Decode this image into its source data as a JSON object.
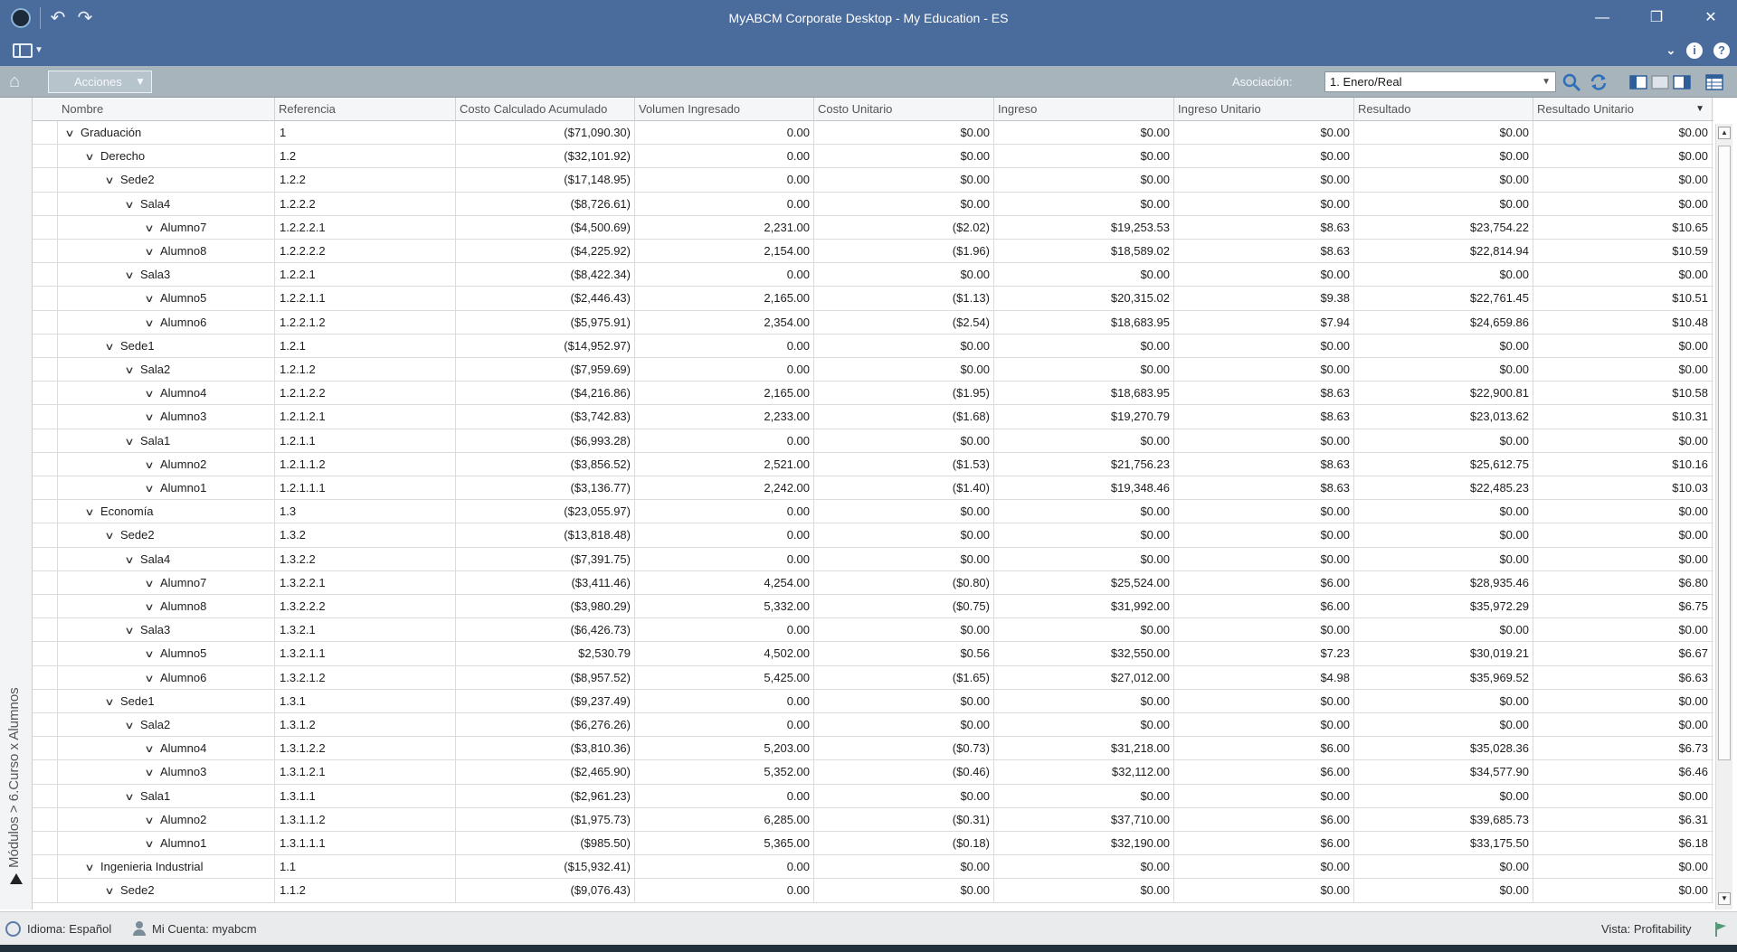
{
  "window": {
    "title": "MyABCM Corporate Desktop - My Education - ES",
    "undo_icon": "undo-icon",
    "redo_icon": "redo-icon"
  },
  "toolbar": {
    "acciones_label": "Acciones",
    "asociacion_label": "Asociación:",
    "asociacion_value": "1. Enero/Real"
  },
  "breadcrumb": "Módulos > 6.Curso x Alumnos",
  "columns": [
    "Nombre",
    "Referencia",
    "Costo Calculado Acumulado",
    "Volumen Ingresado",
    "Costo Unitario",
    "Ingreso",
    "Ingreso Unitario",
    "Resultado",
    "Resultado Unitario"
  ],
  "rows": [
    {
      "level": 0,
      "name": "Graduación",
      "ref": "1",
      "costo_acum": "($71,090.30)",
      "volumen": "0.00",
      "costo_unit": "$0.00",
      "ingreso": "$0.00",
      "ingreso_unit": "$0.00",
      "resultado": "$0.00",
      "resultado_unit": "$0.00"
    },
    {
      "level": 1,
      "name": "Derecho",
      "ref": "1.2",
      "costo_acum": "($32,101.92)",
      "volumen": "0.00",
      "costo_unit": "$0.00",
      "ingreso": "$0.00",
      "ingreso_unit": "$0.00",
      "resultado": "$0.00",
      "resultado_unit": "$0.00"
    },
    {
      "level": 2,
      "name": "Sede2",
      "ref": "1.2.2",
      "costo_acum": "($17,148.95)",
      "volumen": "0.00",
      "costo_unit": "$0.00",
      "ingreso": "$0.00",
      "ingreso_unit": "$0.00",
      "resultado": "$0.00",
      "resultado_unit": "$0.00"
    },
    {
      "level": 3,
      "name": "Sala4",
      "ref": "1.2.2.2",
      "costo_acum": "($8,726.61)",
      "volumen": "0.00",
      "costo_unit": "$0.00",
      "ingreso": "$0.00",
      "ingreso_unit": "$0.00",
      "resultado": "$0.00",
      "resultado_unit": "$0.00"
    },
    {
      "level": 4,
      "name": "Alumno7",
      "ref": "1.2.2.2.1",
      "costo_acum": "($4,500.69)",
      "volumen": "2,231.00",
      "costo_unit": "($2.02)",
      "ingreso": "$19,253.53",
      "ingreso_unit": "$8.63",
      "resultado": "$23,754.22",
      "resultado_unit": "$10.65"
    },
    {
      "level": 4,
      "name": "Alumno8",
      "ref": "1.2.2.2.2",
      "costo_acum": "($4,225.92)",
      "volumen": "2,154.00",
      "costo_unit": "($1.96)",
      "ingreso": "$18,589.02",
      "ingreso_unit": "$8.63",
      "resultado": "$22,814.94",
      "resultado_unit": "$10.59"
    },
    {
      "level": 3,
      "name": "Sala3",
      "ref": "1.2.2.1",
      "costo_acum": "($8,422.34)",
      "volumen": "0.00",
      "costo_unit": "$0.00",
      "ingreso": "$0.00",
      "ingreso_unit": "$0.00",
      "resultado": "$0.00",
      "resultado_unit": "$0.00"
    },
    {
      "level": 4,
      "name": "Alumno5",
      "ref": "1.2.2.1.1",
      "costo_acum": "($2,446.43)",
      "volumen": "2,165.00",
      "costo_unit": "($1.13)",
      "ingreso": "$20,315.02",
      "ingreso_unit": "$9.38",
      "resultado": "$22,761.45",
      "resultado_unit": "$10.51"
    },
    {
      "level": 4,
      "name": "Alumno6",
      "ref": "1.2.2.1.2",
      "costo_acum": "($5,975.91)",
      "volumen": "2,354.00",
      "costo_unit": "($2.54)",
      "ingreso": "$18,683.95",
      "ingreso_unit": "$7.94",
      "resultado": "$24,659.86",
      "resultado_unit": "$10.48"
    },
    {
      "level": 2,
      "name": "Sede1",
      "ref": "1.2.1",
      "costo_acum": "($14,952.97)",
      "volumen": "0.00",
      "costo_unit": "$0.00",
      "ingreso": "$0.00",
      "ingreso_unit": "$0.00",
      "resultado": "$0.00",
      "resultado_unit": "$0.00"
    },
    {
      "level": 3,
      "name": "Sala2",
      "ref": "1.2.1.2",
      "costo_acum": "($7,959.69)",
      "volumen": "0.00",
      "costo_unit": "$0.00",
      "ingreso": "$0.00",
      "ingreso_unit": "$0.00",
      "resultado": "$0.00",
      "resultado_unit": "$0.00"
    },
    {
      "level": 4,
      "name": "Alumno4",
      "ref": "1.2.1.2.2",
      "costo_acum": "($4,216.86)",
      "volumen": "2,165.00",
      "costo_unit": "($1.95)",
      "ingreso": "$18,683.95",
      "ingreso_unit": "$8.63",
      "resultado": "$22,900.81",
      "resultado_unit": "$10.58"
    },
    {
      "level": 4,
      "name": "Alumno3",
      "ref": "1.2.1.2.1",
      "costo_acum": "($3,742.83)",
      "volumen": "2,233.00",
      "costo_unit": "($1.68)",
      "ingreso": "$19,270.79",
      "ingreso_unit": "$8.63",
      "resultado": "$23,013.62",
      "resultado_unit": "$10.31"
    },
    {
      "level": 3,
      "name": "Sala1",
      "ref": "1.2.1.1",
      "costo_acum": "($6,993.28)",
      "volumen": "0.00",
      "costo_unit": "$0.00",
      "ingreso": "$0.00",
      "ingreso_unit": "$0.00",
      "resultado": "$0.00",
      "resultado_unit": "$0.00"
    },
    {
      "level": 4,
      "name": "Alumno2",
      "ref": "1.2.1.1.2",
      "costo_acum": "($3,856.52)",
      "volumen": "2,521.00",
      "costo_unit": "($1.53)",
      "ingreso": "$21,756.23",
      "ingreso_unit": "$8.63",
      "resultado": "$25,612.75",
      "resultado_unit": "$10.16"
    },
    {
      "level": 4,
      "name": "Alumno1",
      "ref": "1.2.1.1.1",
      "costo_acum": "($3,136.77)",
      "volumen": "2,242.00",
      "costo_unit": "($1.40)",
      "ingreso": "$19,348.46",
      "ingreso_unit": "$8.63",
      "resultado": "$22,485.23",
      "resultado_unit": "$10.03"
    },
    {
      "level": 1,
      "name": "Economía",
      "ref": "1.3",
      "costo_acum": "($23,055.97)",
      "volumen": "0.00",
      "costo_unit": "$0.00",
      "ingreso": "$0.00",
      "ingreso_unit": "$0.00",
      "resultado": "$0.00",
      "resultado_unit": "$0.00"
    },
    {
      "level": 2,
      "name": "Sede2",
      "ref": "1.3.2",
      "costo_acum": "($13,818.48)",
      "volumen": "0.00",
      "costo_unit": "$0.00",
      "ingreso": "$0.00",
      "ingreso_unit": "$0.00",
      "resultado": "$0.00",
      "resultado_unit": "$0.00"
    },
    {
      "level": 3,
      "name": "Sala4",
      "ref": "1.3.2.2",
      "costo_acum": "($7,391.75)",
      "volumen": "0.00",
      "costo_unit": "$0.00",
      "ingreso": "$0.00",
      "ingreso_unit": "$0.00",
      "resultado": "$0.00",
      "resultado_unit": "$0.00"
    },
    {
      "level": 4,
      "name": "Alumno7",
      "ref": "1.3.2.2.1",
      "costo_acum": "($3,411.46)",
      "volumen": "4,254.00",
      "costo_unit": "($0.80)",
      "ingreso": "$25,524.00",
      "ingreso_unit": "$6.00",
      "resultado": "$28,935.46",
      "resultado_unit": "$6.80"
    },
    {
      "level": 4,
      "name": "Alumno8",
      "ref": "1.3.2.2.2",
      "costo_acum": "($3,980.29)",
      "volumen": "5,332.00",
      "costo_unit": "($0.75)",
      "ingreso": "$31,992.00",
      "ingreso_unit": "$6.00",
      "resultado": "$35,972.29",
      "resultado_unit": "$6.75"
    },
    {
      "level": 3,
      "name": "Sala3",
      "ref": "1.3.2.1",
      "costo_acum": "($6,426.73)",
      "volumen": "0.00",
      "costo_unit": "$0.00",
      "ingreso": "$0.00",
      "ingreso_unit": "$0.00",
      "resultado": "$0.00",
      "resultado_unit": "$0.00"
    },
    {
      "level": 4,
      "name": "Alumno5",
      "ref": "1.3.2.1.1",
      "costo_acum": "$2,530.79",
      "volumen": "4,502.00",
      "costo_unit": "$0.56",
      "ingreso": "$32,550.00",
      "ingreso_unit": "$7.23",
      "resultado": "$30,019.21",
      "resultado_unit": "$6.67"
    },
    {
      "level": 4,
      "name": "Alumno6",
      "ref": "1.3.2.1.2",
      "costo_acum": "($8,957.52)",
      "volumen": "5,425.00",
      "costo_unit": "($1.65)",
      "ingreso": "$27,012.00",
      "ingreso_unit": "$4.98",
      "resultado": "$35,969.52",
      "resultado_unit": "$6.63"
    },
    {
      "level": 2,
      "name": "Sede1",
      "ref": "1.3.1",
      "costo_acum": "($9,237.49)",
      "volumen": "0.00",
      "costo_unit": "$0.00",
      "ingreso": "$0.00",
      "ingreso_unit": "$0.00",
      "resultado": "$0.00",
      "resultado_unit": "$0.00"
    },
    {
      "level": 3,
      "name": "Sala2",
      "ref": "1.3.1.2",
      "costo_acum": "($6,276.26)",
      "volumen": "0.00",
      "costo_unit": "$0.00",
      "ingreso": "$0.00",
      "ingreso_unit": "$0.00",
      "resultado": "$0.00",
      "resultado_unit": "$0.00"
    },
    {
      "level": 4,
      "name": "Alumno4",
      "ref": "1.3.1.2.2",
      "costo_acum": "($3,810.36)",
      "volumen": "5,203.00",
      "costo_unit": "($0.73)",
      "ingreso": "$31,218.00",
      "ingreso_unit": "$6.00",
      "resultado": "$35,028.36",
      "resultado_unit": "$6.73"
    },
    {
      "level": 4,
      "name": "Alumno3",
      "ref": "1.3.1.2.1",
      "costo_acum": "($2,465.90)",
      "volumen": "5,352.00",
      "costo_unit": "($0.46)",
      "ingreso": "$32,112.00",
      "ingreso_unit": "$6.00",
      "resultado": "$34,577.90",
      "resultado_unit": "$6.46"
    },
    {
      "level": 3,
      "name": "Sala1",
      "ref": "1.3.1.1",
      "costo_acum": "($2,961.23)",
      "volumen": "0.00",
      "costo_unit": "$0.00",
      "ingreso": "$0.00",
      "ingreso_unit": "$0.00",
      "resultado": "$0.00",
      "resultado_unit": "$0.00"
    },
    {
      "level": 4,
      "name": "Alumno2",
      "ref": "1.3.1.1.2",
      "costo_acum": "($1,975.73)",
      "volumen": "6,285.00",
      "costo_unit": "($0.31)",
      "ingreso": "$37,710.00",
      "ingreso_unit": "$6.00",
      "resultado": "$39,685.73",
      "resultado_unit": "$6.31"
    },
    {
      "level": 4,
      "name": "Alumno1",
      "ref": "1.3.1.1.1",
      "costo_acum": "($985.50)",
      "volumen": "5,365.00",
      "costo_unit": "($0.18)",
      "ingreso": "$32,190.00",
      "ingreso_unit": "$6.00",
      "resultado": "$33,175.50",
      "resultado_unit": "$6.18"
    },
    {
      "level": 1,
      "name": "Ingenieria Industrial",
      "ref": "1.1",
      "costo_acum": "($15,932.41)",
      "volumen": "0.00",
      "costo_unit": "$0.00",
      "ingreso": "$0.00",
      "ingreso_unit": "$0.00",
      "resultado": "$0.00",
      "resultado_unit": "$0.00"
    },
    {
      "level": 2,
      "name": "Sede2",
      "ref": "1.1.2",
      "costo_acum": "($9,076.43)",
      "volumen": "0.00",
      "costo_unit": "$0.00",
      "ingreso": "$0.00",
      "ingreso_unit": "$0.00",
      "resultado": "$0.00",
      "resultado_unit": "$0.00"
    }
  ],
  "status": {
    "idioma": "Idioma: Español",
    "cuenta": "Mi Cuenta: myabcm",
    "vista": "Vista: Profitability"
  },
  "colors": {
    "titlebar": "#4a6c9c",
    "toolbar": "#a7b4bc",
    "accent": "#3a78c4"
  }
}
